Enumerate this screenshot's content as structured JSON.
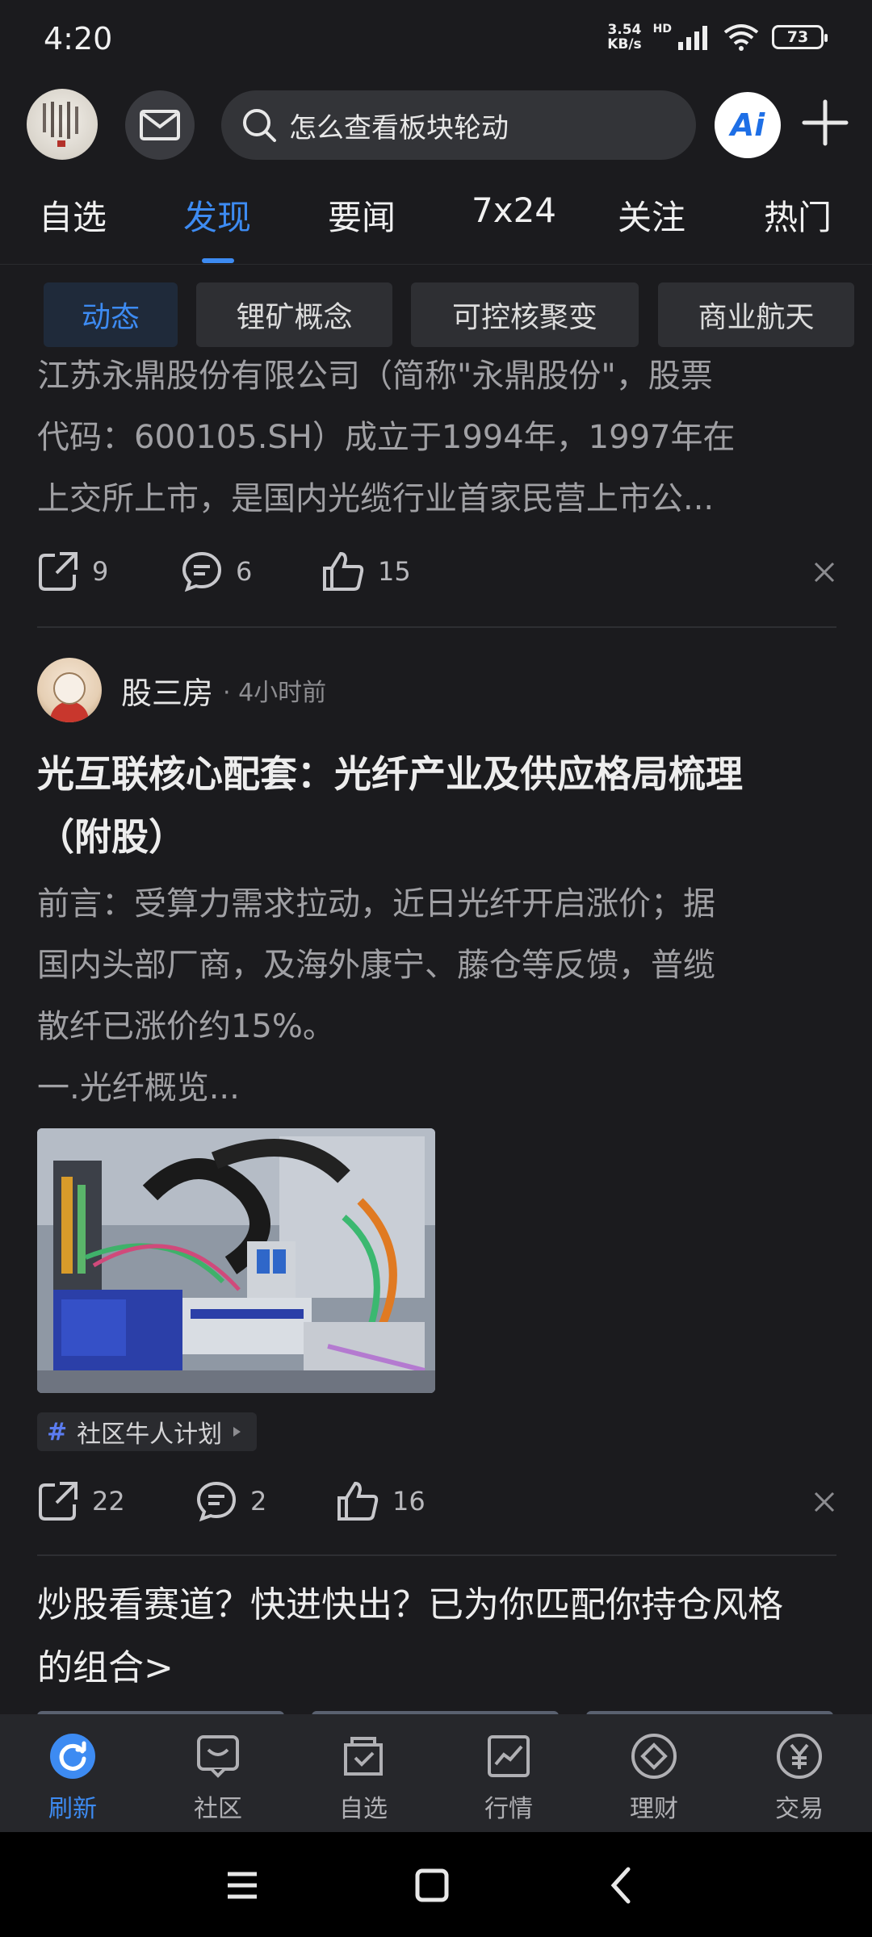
{
  "status_bar": {
    "time": "4:20",
    "net_speed_value": "3.54",
    "net_speed_unit": "KB/s",
    "hd_label": "HD",
    "battery_level": "73"
  },
  "top_bar": {
    "search_placeholder": "怎么查看板块轮动",
    "ai_label": "Ai"
  },
  "tabs": [
    {
      "label": "自选",
      "active": false
    },
    {
      "label": "发现",
      "active": true
    },
    {
      "label": "要闻",
      "active": false
    },
    {
      "label": "7x24",
      "active": false
    },
    {
      "label": "关注",
      "active": false
    },
    {
      "label": "热门",
      "active": false
    }
  ],
  "chips": [
    {
      "label": "动态",
      "active": true
    },
    {
      "label": "锂矿概念",
      "active": false
    },
    {
      "label": "可控核聚变",
      "active": false
    },
    {
      "label": "商业航天",
      "active": false
    }
  ],
  "post1": {
    "lines": [
      "江苏永鼎股份有限公司（简称\"永鼎股份\"，股票",
      "代码：600105.SH）成立于1994年，1997年在",
      "上交所上市，是国内光缆行业首家民营上市公..."
    ],
    "share_count": "9",
    "comment_count": "6",
    "like_count": "15"
  },
  "post2": {
    "author_name": "股三房",
    "time_ago": "4小时前",
    "title_lines": [
      "光互联核心配套：光纤产业及供应格局梳理",
      "（附股）"
    ],
    "body_lines": [
      "前言：受算力需求拉动，近日光纤开启涨价；据",
      "国内头部厂商，及海外康宁、藤仓等反馈，普缆",
      "散纤已涨价约15%。",
      "一.光纤概览..."
    ],
    "tag_label": "社区牛人计划",
    "share_count": "22",
    "comment_count": "2",
    "like_count": "16"
  },
  "promo": {
    "lines": [
      "炒股看赛道？快进快出？已为你匹配你持仓风格",
      "的组合>"
    ]
  },
  "bottom_nav": [
    {
      "label": "刷新",
      "icon": "refresh-icon",
      "active": true
    },
    {
      "label": "社区",
      "icon": "community-icon",
      "active": false
    },
    {
      "label": "自选",
      "icon": "watchlist-icon",
      "active": false
    },
    {
      "label": "行情",
      "icon": "market-icon",
      "active": false
    },
    {
      "label": "理财",
      "icon": "wealth-icon",
      "active": false
    },
    {
      "label": "交易",
      "icon": "trade-icon",
      "active": false
    }
  ],
  "colors": {
    "background": "#1b1b1e",
    "accent": "#3d8bf2",
    "muted_text": "#a0a0a4"
  }
}
